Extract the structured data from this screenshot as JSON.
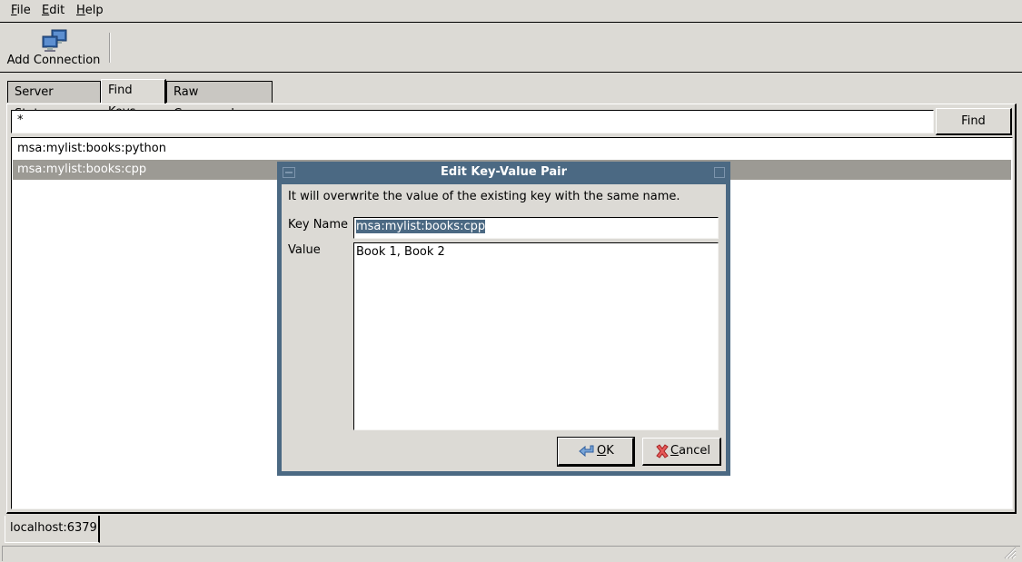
{
  "menubar": {
    "items": [
      {
        "label": "File",
        "mnemonic": "F",
        "rest": "ile"
      },
      {
        "label": "Edit",
        "mnemonic": "E",
        "rest": "dit"
      },
      {
        "label": "Help",
        "mnemonic": "H",
        "rest": "elp"
      }
    ]
  },
  "toolbar": {
    "add_connection_label": "Add Connection",
    "add_connection_icon": "network-computers-icon"
  },
  "tabs": [
    {
      "label": "Server Status",
      "active": false
    },
    {
      "label": "Find Keys",
      "active": true
    },
    {
      "label": "Raw Commands",
      "active": false
    }
  ],
  "find_keys": {
    "search_value": "*",
    "find_button_label": "Find",
    "results": [
      {
        "key": "msa:mylist:books:python",
        "selected": false
      },
      {
        "key": "msa:mylist:books:cpp",
        "selected": true
      }
    ]
  },
  "connections": {
    "tabs": [
      {
        "label": "localhost:6379",
        "active": true
      }
    ]
  },
  "dialog": {
    "title": "Edit Key-Value Pair",
    "message": "It will overwrite the value of the existing key with the same name.",
    "key_name_label": "Key Name",
    "key_name_value": "msa:mylist:books:cpp",
    "value_label": "Value",
    "value_text": "Book 1, Book 2",
    "ok": {
      "mnemonic": "O",
      "rest": "K",
      "icon": "back-arrow-icon"
    },
    "cancel": {
      "mnemonic": "C",
      "rest": "ancel",
      "icon": "red-x-icon"
    },
    "colors": {
      "titlebar": "#4b6983",
      "selection": "#4b6983"
    }
  },
  "colors": {
    "window_bg": "#dcdad5",
    "list_selected_bg": "#9c9a94"
  }
}
